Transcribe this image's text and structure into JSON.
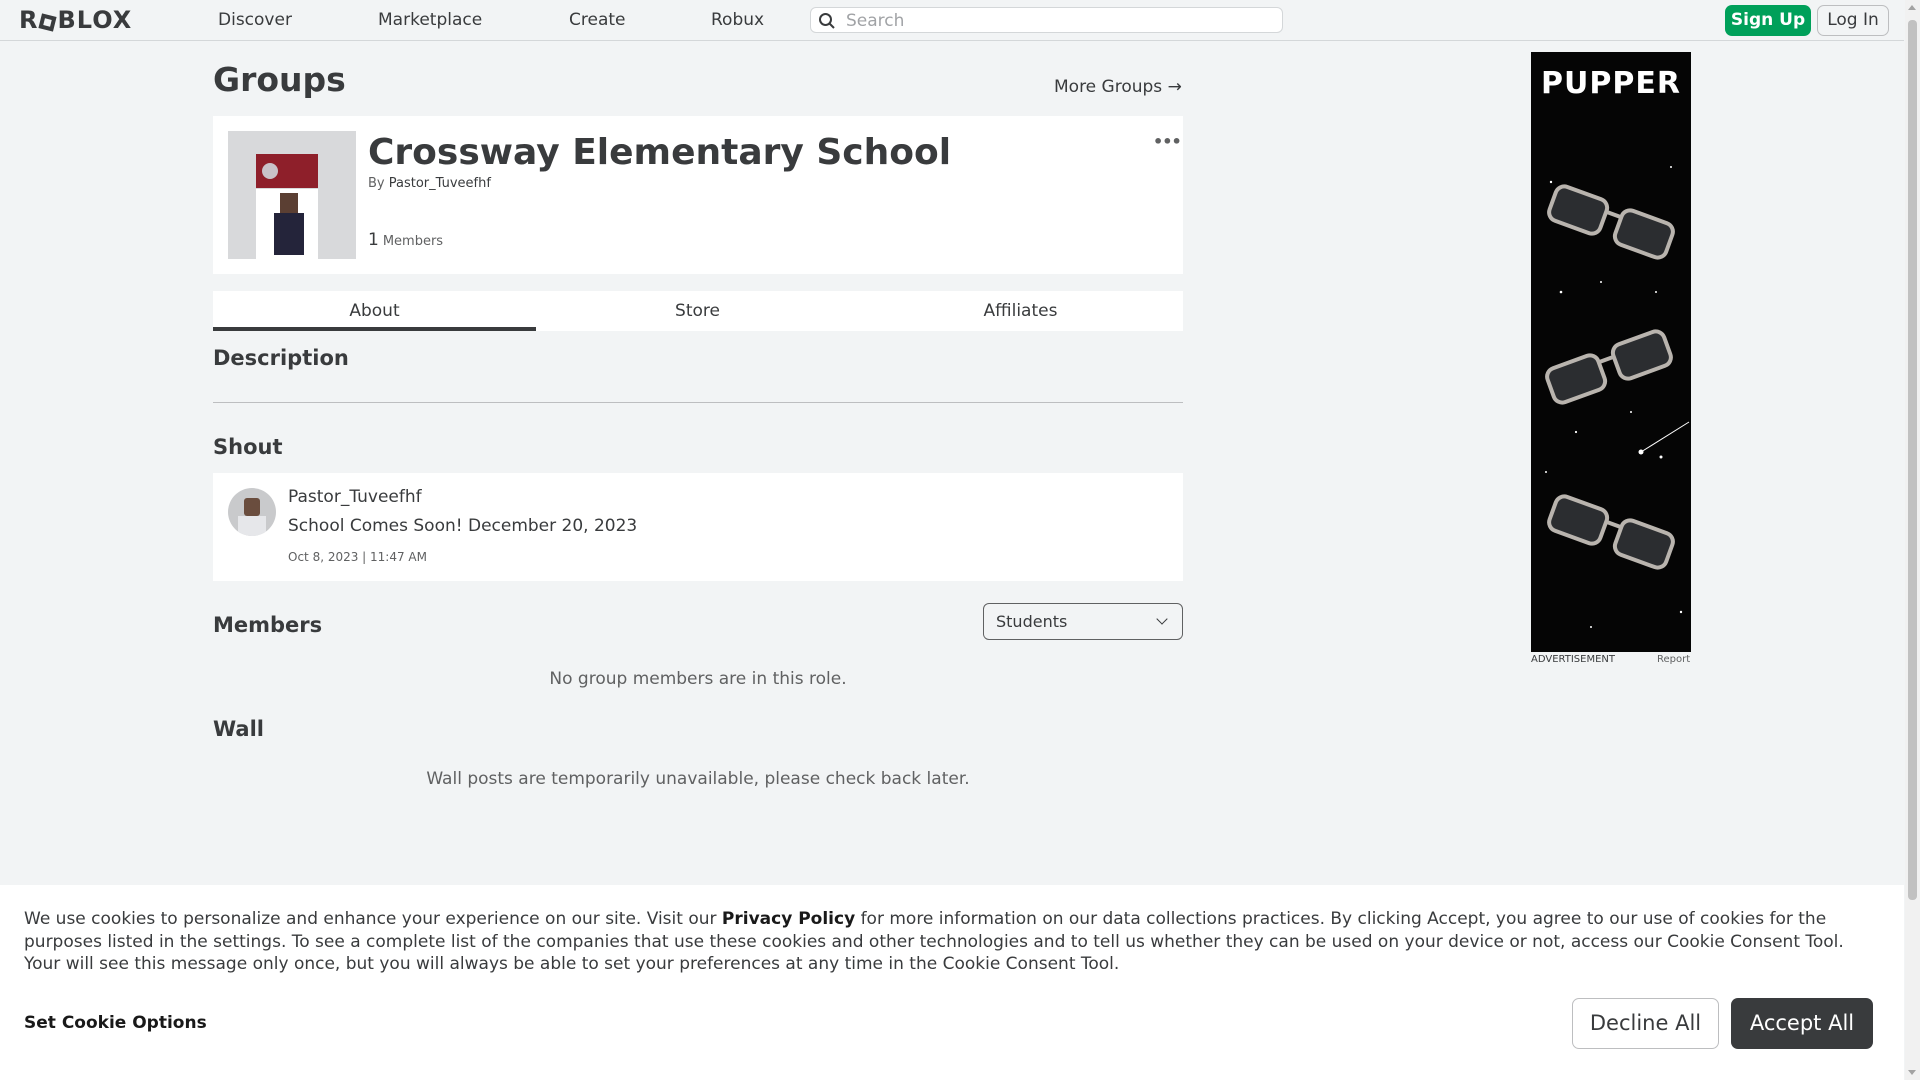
{
  "header": {
    "logo": "ROBLOX",
    "nav": [
      "Discover",
      "Marketplace",
      "Create",
      "Robux"
    ],
    "search_placeholder": "Search",
    "signup_label": "Sign Up",
    "login_label": "Log In"
  },
  "page": {
    "title": "Groups",
    "more_groups": "More Groups →"
  },
  "group": {
    "name": "Crossway Elementary School",
    "by_prefix": "By",
    "owner": "Pastor_Tuveefhf",
    "member_count": "1",
    "members_label": "Members",
    "more_menu": "•••"
  },
  "tabs": [
    "About",
    "Store",
    "Affiliates"
  ],
  "sections": {
    "description": "Description",
    "shout": "Shout",
    "members": "Members",
    "wall": "Wall"
  },
  "shout": {
    "author": "Pastor_Tuveefhf",
    "text": "School Comes Soon! December 20, 2023",
    "date": "Oct 8, 2023 | 11:47 AM"
  },
  "members": {
    "role_selected": "Students",
    "empty_message": "No group members are in this role."
  },
  "wall": {
    "message": "Wall posts are temporarily unavailable, please check back later."
  },
  "ad": {
    "brand": "PUPPER",
    "label": "ADVERTISEMENT",
    "report": "Report"
  },
  "cookie": {
    "text_before": "We use cookies to personalize and enhance your experience on our site. Visit our ",
    "policy_link": "Privacy Policy",
    "text_after": " for more information on our data collections practices. By clicking Accept, you agree to our use of cookies for the purposes listed in the settings. To see a complete list of the companies that use these cookies and other technologies and to tell us whether they can be used on your device or not, access our Cookie Consent Tool. Your will see this message only once, but you will always be able to set your preferences at any time in the Cookie Consent Tool.",
    "options_label": "Set Cookie Options",
    "decline_label": "Decline All",
    "accept_label": "Accept All"
  },
  "colors": {
    "signup_green": "#00a05a",
    "background": "#f2f4f5",
    "accept_dark": "#393b3d"
  }
}
